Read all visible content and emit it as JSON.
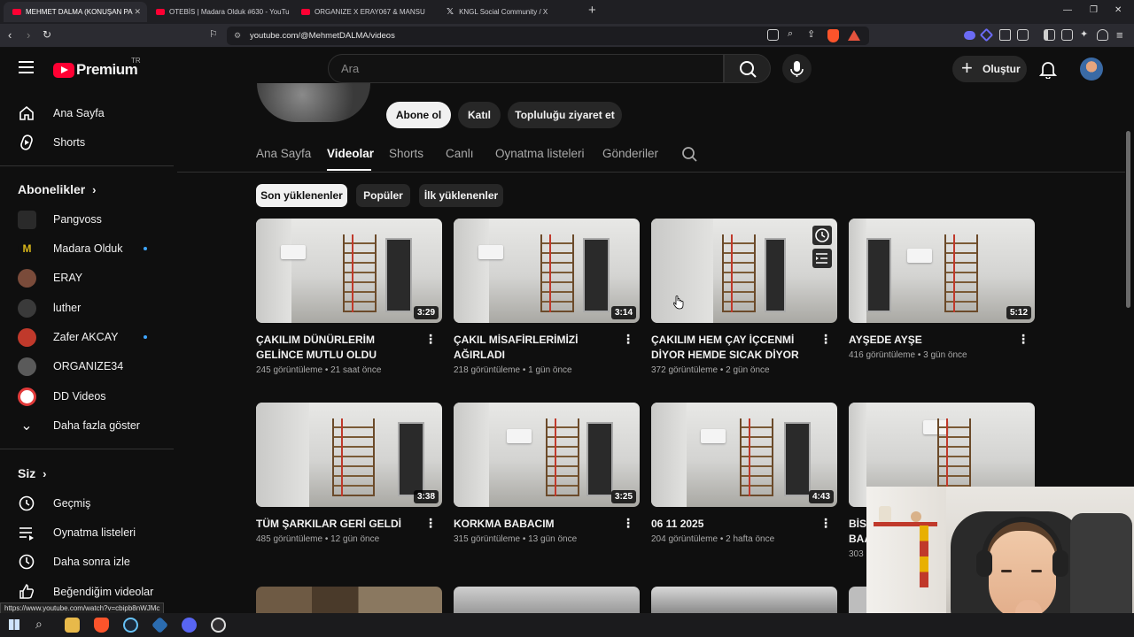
{
  "browser": {
    "tabs": [
      {
        "title": "MEHMET DALMA (KONUŞAN PA",
        "active": true
      },
      {
        "title": "OTEBİS | Madara Olduk #630 - YouTu",
        "active": false
      },
      {
        "title": "ORGANIZE X ERAY067 & MANSU",
        "active": false
      },
      {
        "title": "KNGL Social Community / X",
        "active": false
      }
    ],
    "url": "youtube.com/@MehmetDALMA/videos",
    "status_url": "https://www.youtube.com/watch?v=cbipb8nWJMc"
  },
  "header": {
    "logo_text": "Premium",
    "country_code": "TR",
    "search_placeholder": "Ara",
    "create_label": "Oluştur"
  },
  "sidebar": {
    "main": [
      {
        "label": "Ana Sayfa",
        "icon": "home-icon"
      },
      {
        "label": "Shorts",
        "icon": "shorts-icon"
      }
    ],
    "subscriptions_title": "Abonelikler",
    "subscriptions": [
      {
        "label": "Pangvoss",
        "color": "#2a2a2a",
        "new": false
      },
      {
        "label": "Madara Olduk",
        "color": "#d9b61a",
        "new": true
      },
      {
        "label": "ERAY",
        "color": "#7a4b3a",
        "new": false
      },
      {
        "label": "luther",
        "color": "#3a3a3a",
        "new": false
      },
      {
        "label": "Zafer AKCAY",
        "color": "#c0392b",
        "new": true
      },
      {
        "label": "ORGANIZE34",
        "color": "#5a5a5a",
        "new": false
      },
      {
        "label": "DD Videos",
        "color": "#e23b3b",
        "new": false
      },
      {
        "label": "Daha fazla göster",
        "color": "",
        "new": false
      }
    ],
    "you_title": "Siz",
    "you": [
      {
        "label": "Geçmiş",
        "icon": "history-icon"
      },
      {
        "label": "Oynatma listeleri",
        "icon": "playlists-icon"
      },
      {
        "label": "Daha sonra izle",
        "icon": "watch-later-icon"
      },
      {
        "label": "Beğendiğim videolar",
        "icon": "like-icon"
      }
    ]
  },
  "channel": {
    "subscribe_label": "Abone ol",
    "join_label": "Katıl",
    "community_label": "Topluluğu ziyaret et",
    "tabs": [
      "Ana Sayfa",
      "Videolar",
      "Shorts",
      "Canlı",
      "Oynatma listeleri",
      "Gönderiler"
    ],
    "active_tab": "Videolar",
    "chips": [
      "Son yüklenenler",
      "Popüler",
      "İlk yüklenenler"
    ],
    "active_chip": "Son yüklenenler"
  },
  "videos": [
    {
      "title": "ÇAKILIM DÜNÜRLERİM GELİNCE MUTLU OLDU",
      "duration": "3:29",
      "views": "245 görüntüleme",
      "age": "21 saat önce"
    },
    {
      "title": "ÇAKIL MİSAFİRLERİMİZİ AĞIRLADI",
      "duration": "3:14",
      "views": "218 görüntüleme",
      "age": "1 gün önce"
    },
    {
      "title": "ÇAKILIM HEM ÇAY İÇCENMİ DİYOR HEMDE SICAK DİYOR",
      "duration": "",
      "views": "372 görüntüleme",
      "age": "2 gün önce"
    },
    {
      "title": "AYŞEDE AYŞE",
      "duration": "5:12",
      "views": "416 görüntüleme",
      "age": "3 gün önce"
    },
    {
      "title": "TÜM ŞARKILAR GERİ GELDİ",
      "duration": "3:38",
      "views": "485 görüntüleme",
      "age": "12 gün önce"
    },
    {
      "title": "KORKMA BABACIM",
      "duration": "3:25",
      "views": "315 görüntüleme",
      "age": "13 gün önce"
    },
    {
      "title": "06 11 2025",
      "duration": "4:43",
      "views": "204 görüntüleme",
      "age": "2 hafta önce"
    },
    {
      "title": "BİS BAA",
      "duration": "",
      "views": "303",
      "age": ""
    }
  ]
}
